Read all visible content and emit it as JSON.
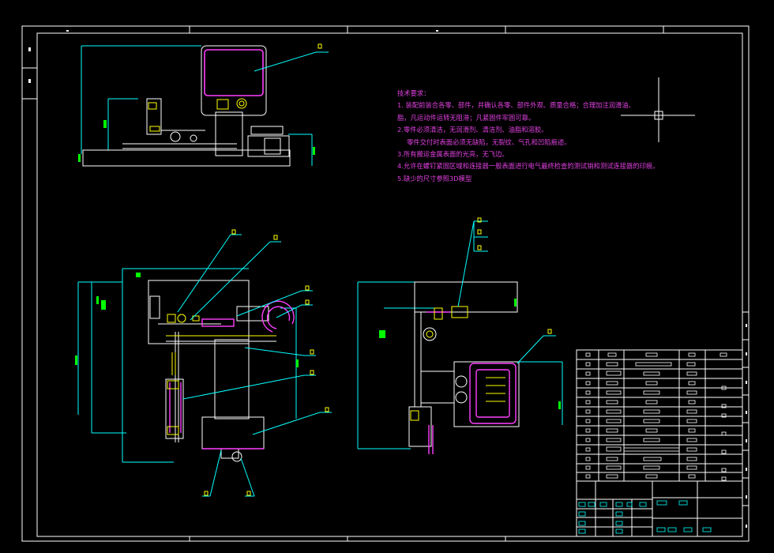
{
  "drawing": {
    "colors": {
      "background": "#000000",
      "frame": "#ffffff",
      "geometry": "#ffffff",
      "dimension": "#00ffff",
      "leader": "#00ffff",
      "annotation": "#ffff00",
      "part": "#ff40ff",
      "notes_text": "#e040e0",
      "hatch": "#00ff00",
      "table_cell": "#00ffff"
    }
  },
  "technical_requirements": {
    "title": "技术要求：",
    "items": [
      "1. 装配前装合各零、部件，并确认各零、部件外观、质量合格；合理加注润滑油、",
      "脂，凡运动件运转无阻滞；凡紧固件牢固可靠。",
      "2.零件必须清洁，无润滑剂、清洁剂、油脂和溶胶。",
      "零件交付时表面必须无缺陷，无裂纹、气孔和凹陷痕迹。",
      "3.所有搬运金属表面的光亮，无飞边。",
      "4.允许在螺钉紧固区域和连接器一般表面进行电气最终检查的测试销和测试连接器的印痕。",
      "5.缺少的尺寸参照3D模型"
    ]
  }
}
